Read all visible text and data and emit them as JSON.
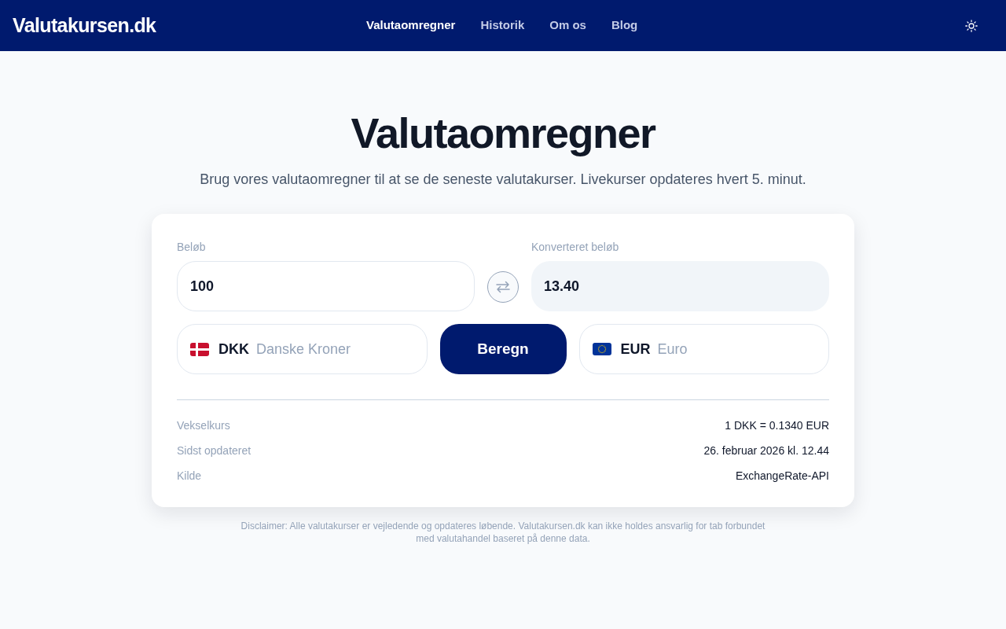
{
  "header": {
    "logo": "Valutakursen.dk",
    "nav": [
      {
        "label": "Valutaomregner",
        "selected": true
      },
      {
        "label": "Historik",
        "selected": false
      },
      {
        "label": "Om os",
        "selected": false
      },
      {
        "label": "Blog",
        "selected": false
      }
    ]
  },
  "hero": {
    "title": "Valutaomregner",
    "subtitle": "Brug vores valutaomregner til at se de seneste valutakurser. Livekurser opdateres hvert 5. minut."
  },
  "converter": {
    "amount": {
      "label": "Beløb",
      "value": "100"
    },
    "converted": {
      "label": "Konverteret beløb",
      "value": "13.40"
    },
    "from_currency": {
      "code": "DKK",
      "name": "Danske Kroner"
    },
    "calculate_button": "Beregn",
    "to_currency": {
      "code": "EUR",
      "name": "Euro"
    }
  },
  "details": [
    {
      "label": "Vekselkurs",
      "value": "1 DKK = 0.1340 EUR"
    },
    {
      "label": "Sidst opdateret",
      "value": "26. februar 2026 kl. 12.44"
    },
    {
      "label": "Kilde",
      "value": "ExchangeRate-API"
    }
  ],
  "disclaimer": "Disclaimer: Alle valutakurser er vejledende og opdateres løbende. Valutakursen.dk kan ikke holdes ansvarlig for tab forbundet med valutahandel baseret på denne data."
}
